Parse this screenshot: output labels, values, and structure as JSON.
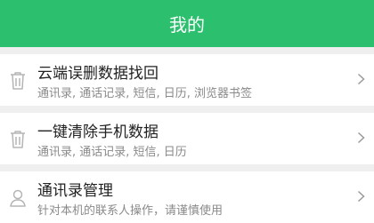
{
  "header": {
    "title": "我的"
  },
  "items": [
    {
      "title": "云端误删数据找回",
      "subtitle": "通讯录, 通话记录, 短信, 日历, 浏览器书签",
      "icon": "trash-icon"
    },
    {
      "title": "一键清除手机数据",
      "subtitle": "通讯录, 通话记录, 短信, 日历",
      "icon": "trash-icon"
    },
    {
      "title": "通讯录管理",
      "subtitle": "针对本机的联系人操作，请谨慎使用",
      "icon": "person-icon"
    }
  ],
  "colors": {
    "header": "#2bbf6e",
    "icon": "#b5b5b5",
    "chevron": "#9a9a9a"
  }
}
